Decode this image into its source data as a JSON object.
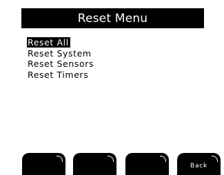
{
  "header": {
    "title": "Reset Menu"
  },
  "menu": {
    "items": [
      {
        "label": "Reset All",
        "selected": true
      },
      {
        "label": "Reset System",
        "selected": false
      },
      {
        "label": "Reset Sensors",
        "selected": false
      },
      {
        "label": "Reset Timers",
        "selected": false
      }
    ]
  },
  "softkeys": [
    {
      "label": ""
    },
    {
      "label": ""
    },
    {
      "label": ""
    },
    {
      "label": "Back"
    }
  ],
  "colors": {
    "background": "#ffffff",
    "foreground": "#000000",
    "inverse_text": "#ffffff"
  }
}
